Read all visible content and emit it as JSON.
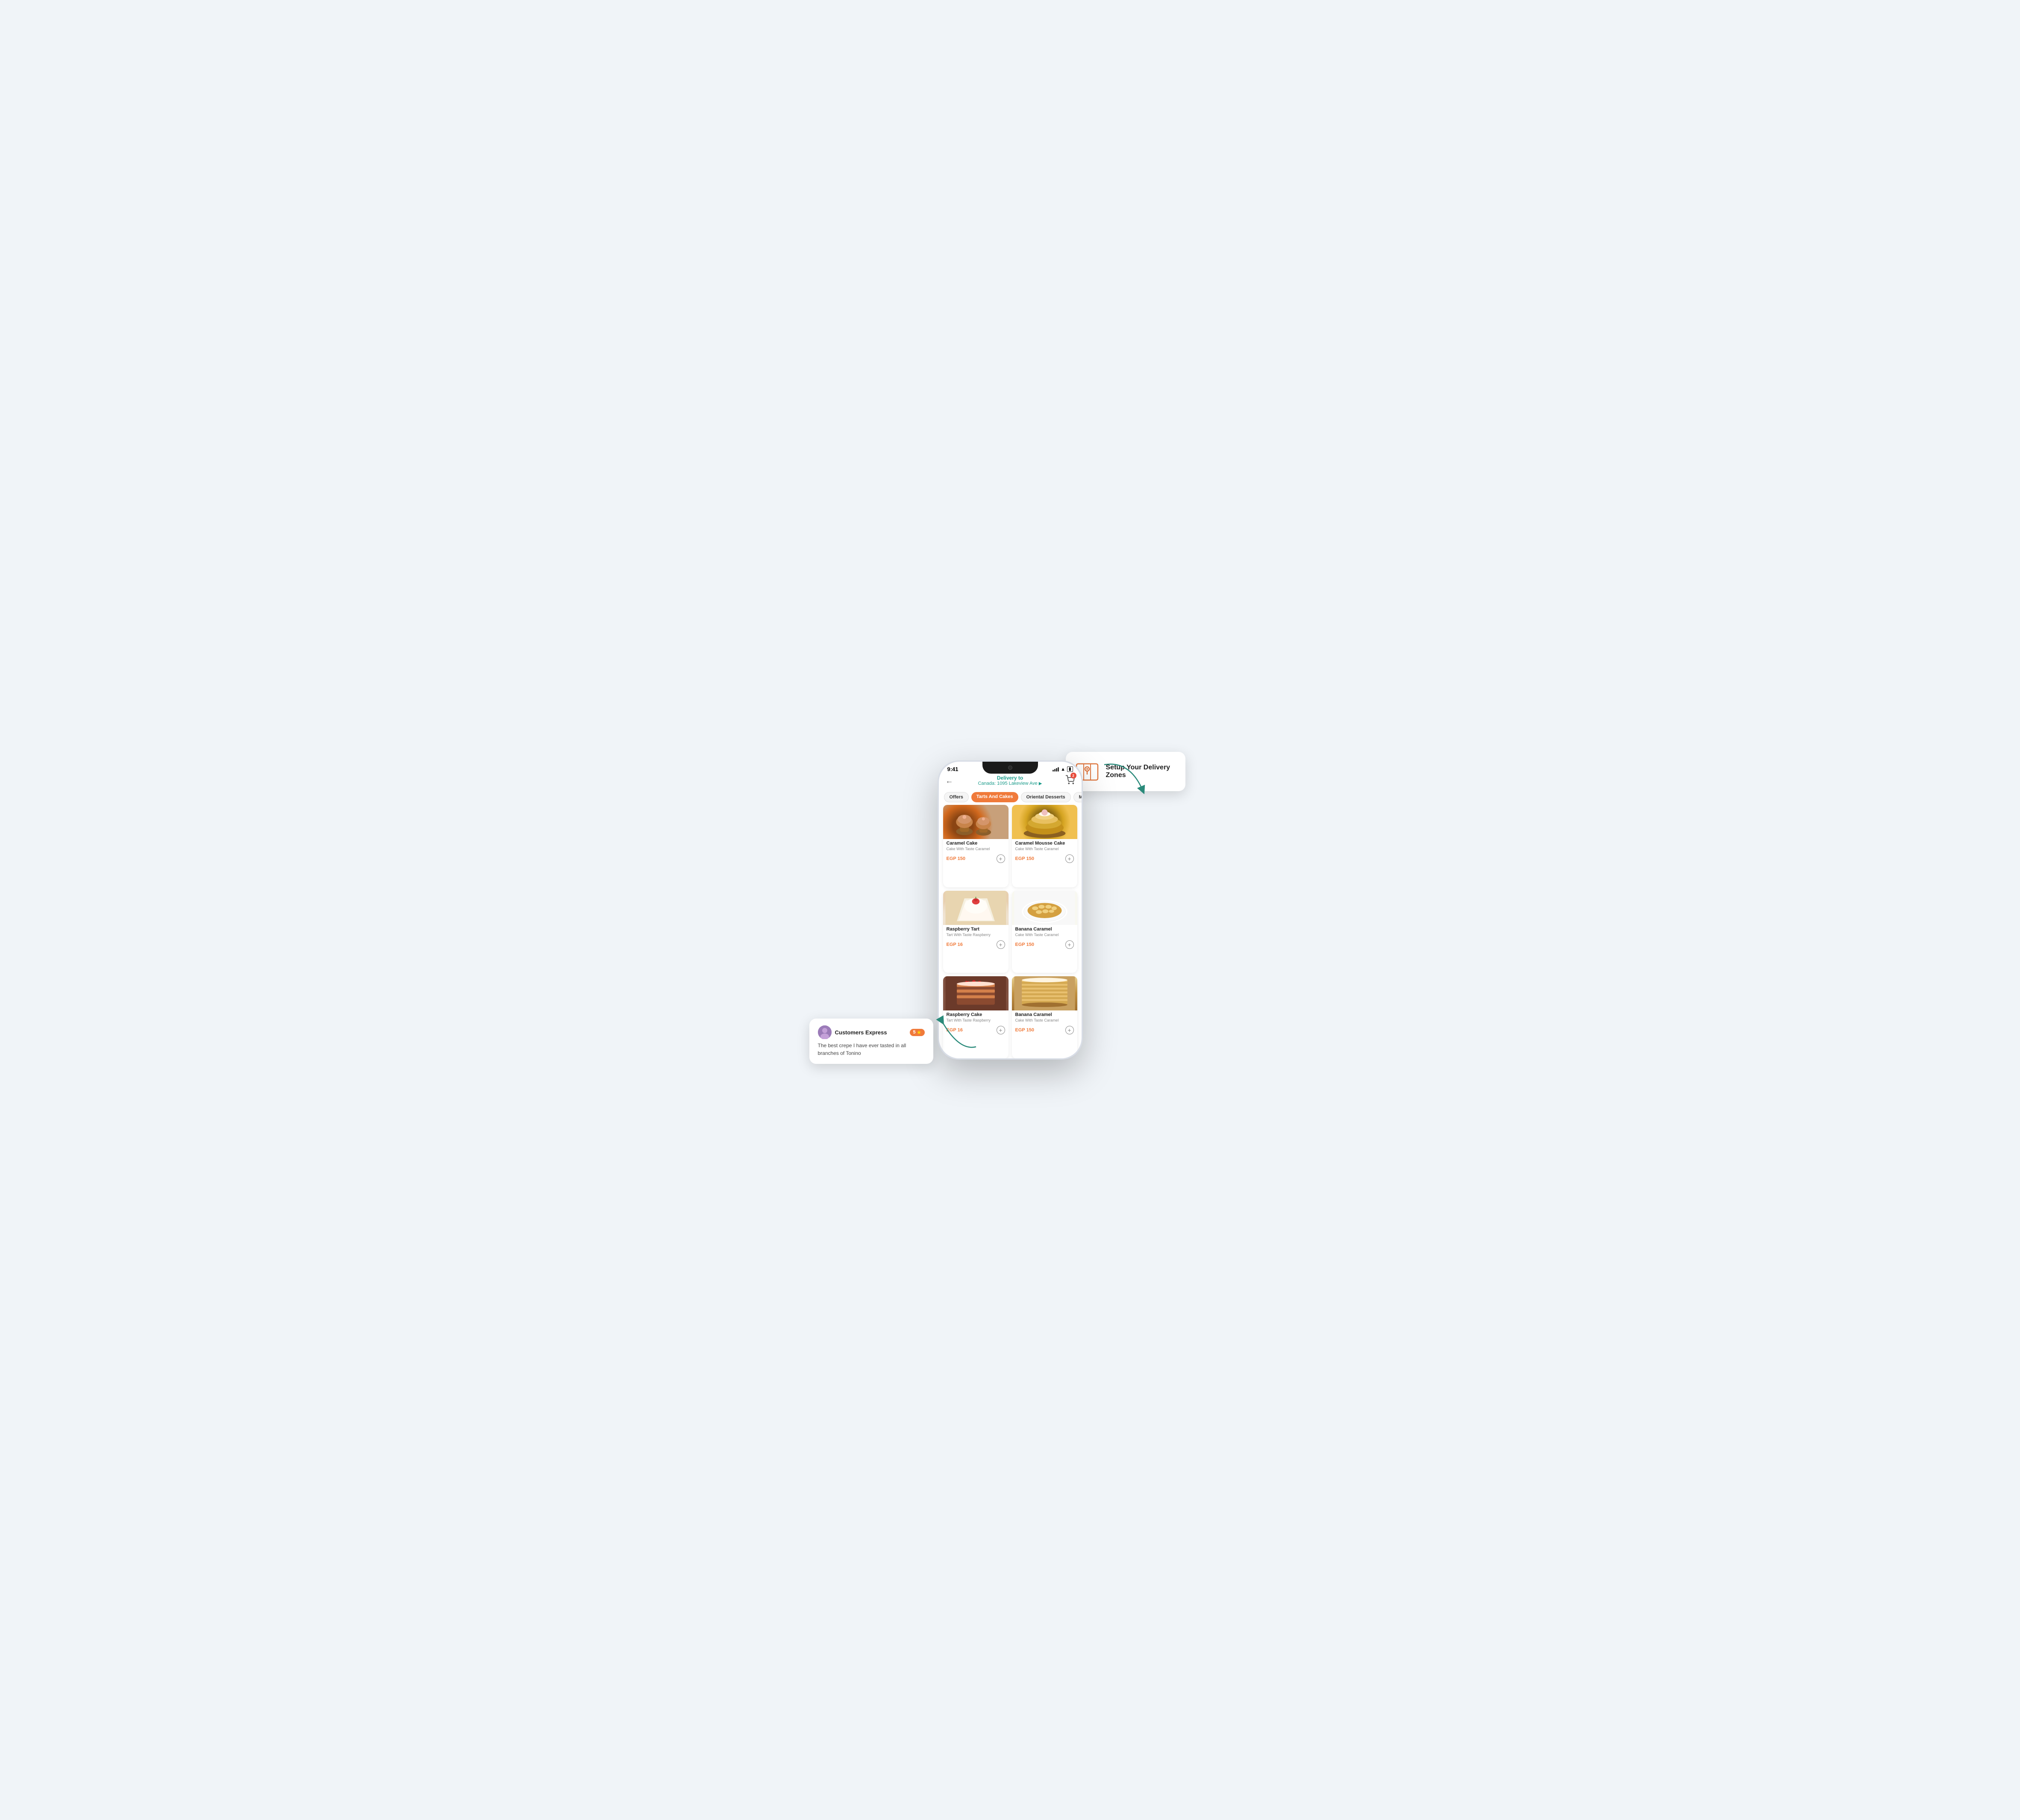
{
  "status_bar": {
    "time": "9:41",
    "signal": "●●●",
    "wifi": "WiFi",
    "battery": "🔋"
  },
  "header": {
    "back_label": "←",
    "delivery_label": "Delivery to",
    "address": "Canada: 1095 Lakeview Ave",
    "cart_badge": "2"
  },
  "tabs": [
    {
      "label": "Offers",
      "active": false
    },
    {
      "label": "Tarts And Cakes",
      "active": true
    },
    {
      "label": "Oriental Desserts",
      "active": false
    },
    {
      "label": "More",
      "active": false
    }
  ],
  "products": [
    {
      "name": "Caramel Cake",
      "description": "Cake With Taste Caramel",
      "price": "EGP 150",
      "image_type": "cupcakes"
    },
    {
      "name": "Caramel Mousse Cake",
      "description": "Cake With Taste Caramel",
      "price": "EGP 150",
      "image_type": "mousse"
    },
    {
      "name": "Raspberry Tart",
      "description": "Tart With Taste Raspberry",
      "price": "EGP 16",
      "image_type": "rtart"
    },
    {
      "name": "Banana Caramel",
      "description": "Cake With Taste Caramel",
      "price": "EGP 150",
      "image_type": "banana"
    },
    {
      "name": "Raspberry Cake",
      "description": "Tart With Taste Raspberry",
      "price": "EGP 16",
      "image_type": "rcake"
    },
    {
      "name": "Banana Caramel",
      "description": "Cake With Taste Caramel",
      "price": "EGP 150",
      "image_type": "banana2"
    }
  ],
  "tooltip_delivery": {
    "title": "Setup Your Delivery Zones",
    "icon": "map"
  },
  "tooltip_customer": {
    "name": "Customers Express",
    "rating": "5",
    "review": "The best crepe I have ever tasted in all branches of Tonino"
  }
}
